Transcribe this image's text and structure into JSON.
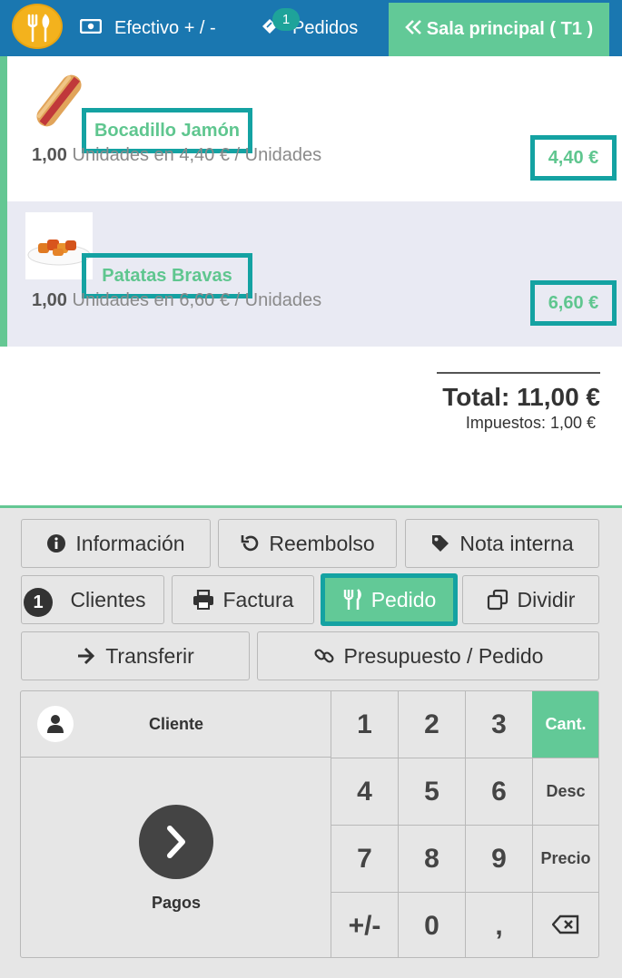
{
  "header": {
    "cash_label": "Efectivo + / -",
    "orders_label": "Pedidos",
    "orders_count": "1",
    "room_label": "Sala principal ( T1 )"
  },
  "order": {
    "lines": [
      {
        "name": "Bocadillo Jamón",
        "qty": "1,00",
        "unit_text": "Unidades en 4,40 € / Unidades",
        "price": "4,40 €"
      },
      {
        "name": "Patatas Bravas",
        "qty": "1,00",
        "unit_text": "Unidades en 6,60 € / Unidades",
        "price": "6,60 €"
      }
    ],
    "total": "Total: 11,00 €",
    "taxes": "Impuestos: 1,00 €"
  },
  "actions": {
    "info": "Información",
    "refund": "Reembolso",
    "note": "Nota interna",
    "customers": "Clientes",
    "customers_count": "1",
    "invoice": "Factura",
    "order": "Pedido",
    "split": "Dividir",
    "transfer": "Transferir",
    "quote": "Presupuesto / Pedido"
  },
  "numpad": {
    "customer": "Cliente",
    "payments": "Pagos",
    "keys": {
      "k1": "1",
      "k2": "2",
      "k3": "3",
      "qty": "Cant.",
      "k4": "4",
      "k5": "5",
      "k6": "6",
      "disc": "Desc",
      "k7": "7",
      "k8": "8",
      "k9": "9",
      "price": "Precio",
      "sign": "+/-",
      "k0": "0",
      "dot": ","
    }
  },
  "colors": {
    "header": "#1a77b0",
    "accent_green": "#62c997",
    "highlight_teal": "#14a2a2"
  }
}
